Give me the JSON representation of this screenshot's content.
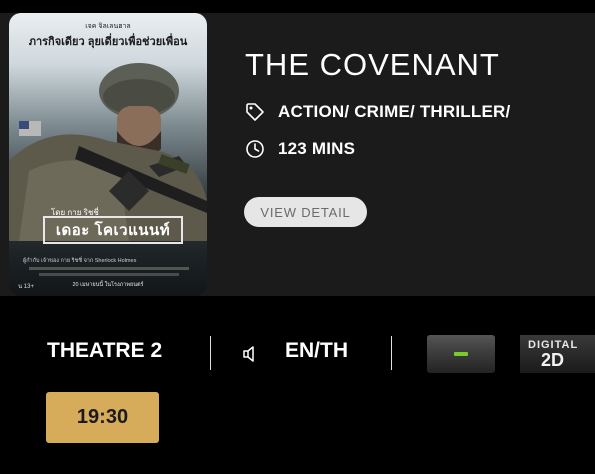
{
  "movie": {
    "title": "THE COVENANT",
    "genre": "ACTION/ CRIME/ THRILLER/",
    "duration": "123 MINS",
    "detail_button": "VIEW DETAIL",
    "poster": {
      "tagline_small": "เจค จิลเลนฮาล",
      "tagline": "ภารกิจเดียว ลุยเดี่ยวเพื่อช่วยเพื่อน",
      "director_line": "โดย กาย ริชชี่",
      "thai_title": "เดอะ โคเวแนนท์",
      "credit_line": "ผู้กำกับ เจ้าของ กาย ริชชี่ จาก Sherlock Holmes",
      "release": "20 เมษายนนี้ ในโรงภาพยนตร์",
      "rating": "น 13+"
    }
  },
  "showtime": {
    "theatre": "THEATRE 2",
    "language": "EN/TH",
    "format_line1": "DIGITAL",
    "format_line2": "2D",
    "times": [
      "19:30"
    ]
  },
  "colors": {
    "time_button": "#d6ab5a",
    "format_dash": "#7acb2c",
    "card_bg": "#1b1b1b"
  },
  "icons": {
    "genre": "tag-icon",
    "duration": "clock-icon",
    "audio": "speaker-icon"
  }
}
